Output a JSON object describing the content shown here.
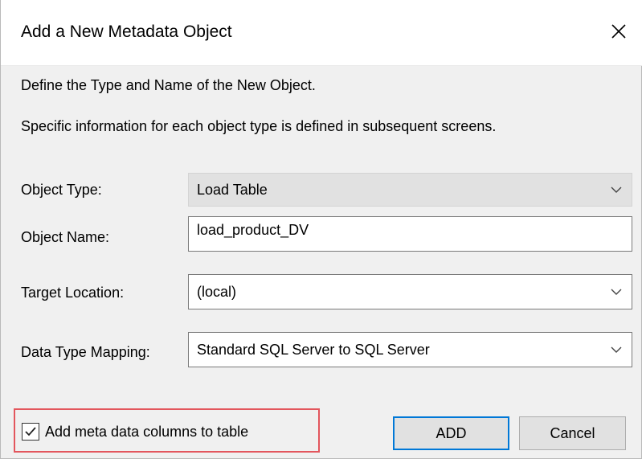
{
  "dialog": {
    "title": "Add a New Metadata Object",
    "close_icon": "close-icon"
  },
  "intro": {
    "line1": "Define the Type and Name of the New Object.",
    "line2": "Specific information for each object type is defined in subsequent screens."
  },
  "form": {
    "object_type": {
      "label": "Object Type:",
      "value": "Load Table"
    },
    "object_name": {
      "label": "Object Name:",
      "value": "load_product_DV"
    },
    "target_location": {
      "label": "Target Location:",
      "value": "(local)"
    },
    "data_type_mapping": {
      "label": "Data Type Mapping:",
      "value": "Standard SQL Server to SQL Server"
    }
  },
  "options": {
    "add_meta_columns": {
      "label": "Add meta data columns to table",
      "checked": true
    }
  },
  "buttons": {
    "add": "ADD",
    "cancel": "Cancel"
  },
  "colors": {
    "highlight": "#e3565d",
    "default_button_border": "#0078d7"
  }
}
